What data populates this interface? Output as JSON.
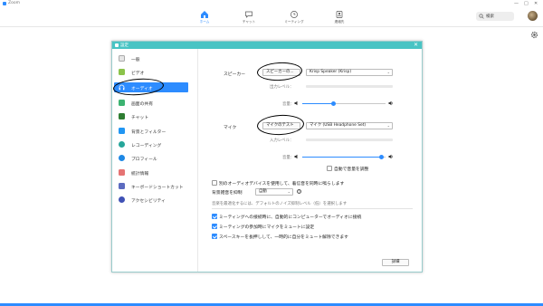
{
  "window": {
    "title": "Zoom",
    "controls": [
      "—",
      "□",
      "✕"
    ]
  },
  "topnav": {
    "items": [
      {
        "label": "ホーム",
        "icon": "home-icon",
        "active": true
      },
      {
        "label": "チャット",
        "icon": "chat-icon",
        "active": false
      },
      {
        "label": "ミーティング",
        "icon": "meeting-clock-icon",
        "active": false
      },
      {
        "label": "連絡先",
        "icon": "contacts-icon",
        "active": false
      }
    ],
    "search": {
      "label": "検索"
    },
    "accent": "#2d8cff"
  },
  "dialog": {
    "title": "設定",
    "close": "✕",
    "header_color": "#48c4c4",
    "sidebar": [
      {
        "label": "一般",
        "icon": "general-icon",
        "color": "#e8e8e8"
      },
      {
        "label": "ビデオ",
        "icon": "video-icon",
        "color": "#8bc34a"
      },
      {
        "label": "オーディオ",
        "icon": "headphones-icon",
        "color": "#2d8cff",
        "active": true
      },
      {
        "label": "画面の共有",
        "icon": "share-screen-icon",
        "color": "#3cb371"
      },
      {
        "label": "チャット",
        "icon": "chat-icon",
        "color": "#2e7d32"
      },
      {
        "label": "背景とフィルター",
        "icon": "background-icon",
        "color": "#2196f3"
      },
      {
        "label": "レコーディング",
        "icon": "recording-icon",
        "color": "#26a69a"
      },
      {
        "label": "プロフィール",
        "icon": "profile-icon",
        "color": "#1e88e5"
      },
      {
        "label": "統計情報",
        "icon": "statistics-icon",
        "color": "#e57373"
      },
      {
        "label": "キーボードショートカット",
        "icon": "keyboard-icon",
        "color": "#5c6bc0"
      },
      {
        "label": "アクセシビリティ",
        "icon": "accessibility-icon",
        "color": "#3f51b5"
      }
    ],
    "audio": {
      "speaker": {
        "section_label": "スピーカー",
        "test_button": "スピーカーの...",
        "device": "Krisp Speaker (Krisp)",
        "output_level_label": "出力レベル：",
        "volume_label": "音量：",
        "volume_level": 0.38
      },
      "mic": {
        "section_label": "マイク",
        "test_button": "マイクのテスト",
        "device": "マイク (USB Headphone Set)",
        "input_level_label": "入力レベル：",
        "volume_label": "音量：",
        "volume_level": 0.95,
        "auto_adjust_label": "自動で音量を調整",
        "auto_adjust": false
      },
      "separate_device_label": "別のオーディオデバイスを使用して、着信音を同時に鳴らします",
      "separate_device": false,
      "suppress_noise_label": "背景雑音を抑制",
      "suppress_noise_value": "自動",
      "noise_hint": "音楽を最適化するには、デフォルトのノイズ抑制レベル（低）を選択します",
      "options": [
        {
          "label": "ミーティングへの接続時に、自動的にコンピューターでオーディオに接続",
          "checked": true
        },
        {
          "label": "ミーティングの参加時にマイクをミュートに設定",
          "checked": true
        },
        {
          "label": "スペースキーを長押しして、一時的に自分をミュート解除できます",
          "checked": true
        }
      ],
      "advanced_button": "詳細"
    }
  }
}
